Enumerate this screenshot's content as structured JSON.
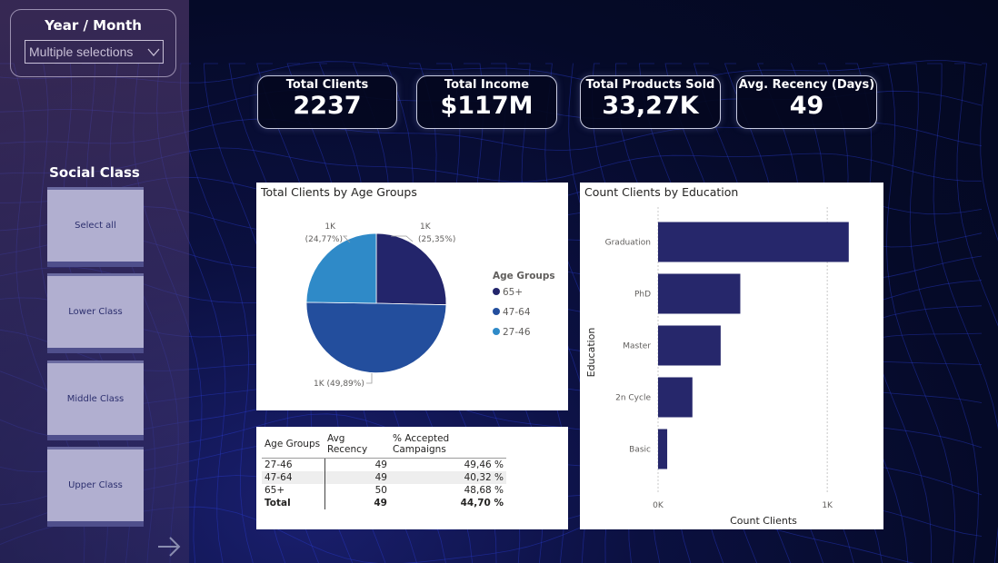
{
  "filters": {
    "year_month": {
      "title": "Year / Month",
      "value": "Multiple selections"
    },
    "social_class": {
      "title": "Social Class",
      "options": [
        "Select all",
        "Lower Class",
        "Middle Class",
        "Upper Class"
      ]
    }
  },
  "kpis": [
    {
      "label": "Total Clients",
      "value": "2237"
    },
    {
      "label": "Total Income",
      "value": "$117M"
    },
    {
      "label": "Total Products Sold",
      "value": "33,27K"
    },
    {
      "label": "Avg. Recency (Days)",
      "value": "49"
    }
  ],
  "colors": {
    "dark_navy": "#23256b",
    "mid_blue": "#234e9d",
    "light_blue": "#2f8ac8",
    "bar": "#26276b"
  },
  "chart_data": [
    {
      "type": "pie",
      "title": "Total Clients by Age Groups",
      "legend_title": "Age Groups",
      "legend_position": "right",
      "slices": [
        {
          "label": "65+",
          "value": 25.35,
          "display_value": "1K",
          "percent": "(25,35%)",
          "color": "#23256b"
        },
        {
          "label": "47-64",
          "value": 49.89,
          "display_value": "1K",
          "percent": "(49,89%)",
          "color": "#234e9d"
        },
        {
          "label": "27-46",
          "value": 24.77,
          "display_value": "1K",
          "percent": "(24,77%)",
          "color": "#2f8ac8"
        }
      ],
      "data_labels": [
        "1K\n(25,35%)",
        "1K (49,89%)",
        "1K\n(24,77%)"
      ]
    },
    {
      "type": "bar",
      "orientation": "horizontal",
      "title": "Count Clients by Education",
      "categories": [
        "Graduation",
        "PhD",
        "Master",
        "2n Cycle",
        "Basic"
      ],
      "values": [
        1127,
        486,
        370,
        203,
        54
      ],
      "xlabel": "Count Clients",
      "ylabel": "Education",
      "xlim": [
        0,
        1300
      ],
      "x_ticks": [
        {
          "value": 0,
          "label": "0K"
        },
        {
          "value": 1000,
          "label": "1K"
        }
      ],
      "grid": "vertical dashed"
    },
    {
      "type": "table",
      "columns": [
        "Age Groups",
        "Avg Recency",
        "% Accepted Campaigns"
      ],
      "rows": [
        [
          "27-46",
          "49",
          "49,46 %"
        ],
        [
          "47-64",
          "49",
          "40,32 %"
        ],
        [
          "65+",
          "50",
          "48,68 %"
        ]
      ],
      "total": [
        "Total",
        "49",
        "44,70 %"
      ]
    }
  ]
}
